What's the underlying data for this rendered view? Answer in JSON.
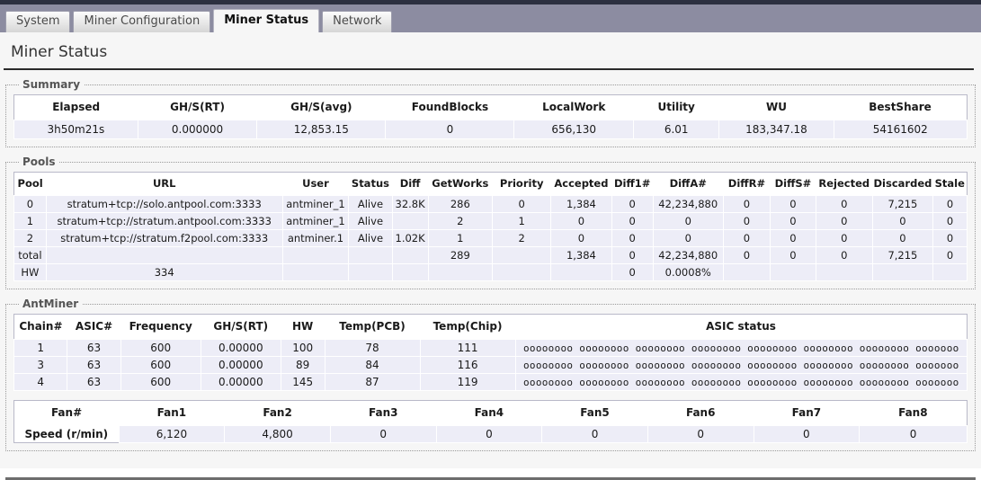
{
  "tabs": [
    {
      "label": "System",
      "active": false
    },
    {
      "label": "Miner Configuration",
      "active": false
    },
    {
      "label": "Miner Status",
      "active": true
    },
    {
      "label": "Network",
      "active": false
    }
  ],
  "page_title": "Miner Status",
  "summary": {
    "legend": "Summary",
    "headers": [
      "Elapsed",
      "GH/S(RT)",
      "GH/S(avg)",
      "FoundBlocks",
      "LocalWork",
      "Utility",
      "WU",
      "BestShare"
    ],
    "row": [
      "3h50m21s",
      "0.000000",
      "12,853.15",
      "0",
      "656,130",
      "6.01",
      "183,347.18",
      "54161602"
    ]
  },
  "pools": {
    "legend": "Pools",
    "headers": [
      "Pool",
      "URL",
      "User",
      "Status",
      "Diff",
      "GetWorks",
      "Priority",
      "Accepted",
      "Diff1#",
      "DiffA#",
      "DiffR#",
      "DiffS#",
      "Rejected",
      "Discarded",
      "Stale"
    ],
    "rows": [
      [
        "0",
        "stratum+tcp://solo.antpool.com:3333",
        "antminer_1",
        "Alive",
        "32.8K",
        "286",
        "0",
        "1,384",
        "0",
        "42,234,880",
        "0",
        "0",
        "0",
        "7,215",
        "0"
      ],
      [
        "1",
        "stratum+tcp://stratum.antpool.com:3333",
        "antminer_1",
        "Alive",
        "",
        "2",
        "1",
        "0",
        "0",
        "0",
        "0",
        "0",
        "0",
        "0",
        "0"
      ],
      [
        "2",
        "stratum+tcp://stratum.f2pool.com:3333",
        "antminer.1",
        "Alive",
        "1.02K",
        "1",
        "2",
        "0",
        "0",
        "0",
        "0",
        "0",
        "0",
        "0",
        "0"
      ],
      [
        "total",
        "",
        "",
        "",
        "",
        "289",
        "",
        "1,384",
        "0",
        "42,234,880",
        "0",
        "0",
        "0",
        "7,215",
        "0"
      ],
      [
        "HW",
        "334",
        "",
        "",
        "",
        "",
        "",
        "",
        "0",
        "0.0008%",
        "",
        "",
        "",
        "",
        ""
      ]
    ]
  },
  "antminer": {
    "legend": "AntMiner",
    "headers": [
      "Chain#",
      "ASIC#",
      "Frequency",
      "GH/S(RT)",
      "HW",
      "Temp(PCB)",
      "Temp(Chip)",
      "ASIC status"
    ],
    "rows": [
      [
        "1",
        "63",
        "600",
        "0.00000",
        "100",
        "78",
        "111",
        "oooooooo oooooooo oooooooo oooooooo oooooooo oooooooo oooooooo ooooooo"
      ],
      [
        "3",
        "63",
        "600",
        "0.00000",
        "89",
        "84",
        "116",
        "oooooooo oooooooo oooooooo oooooooo oooooooo oooooooo oooooooo ooooooo"
      ],
      [
        "4",
        "63",
        "600",
        "0.00000",
        "145",
        "87",
        "119",
        "oooooooo oooooooo oooooooo oooooooo oooooooo oooooooo oooooooo ooooooo"
      ]
    ],
    "fan_headers": [
      "Fan#",
      "Fan1",
      "Fan2",
      "Fan3",
      "Fan4",
      "Fan5",
      "Fan6",
      "Fan7",
      "Fan8"
    ],
    "fan_row_label": "Speed (r/min)",
    "fan_values": [
      "6,120",
      "4,800",
      "0",
      "0",
      "0",
      "0",
      "0",
      "0"
    ]
  },
  "colors": {
    "tabbar_bg": "#8c8ca1",
    "row_bg": "#ededf7",
    "page_bg": "#f6f6f6",
    "accent_dark": "#2c3040"
  }
}
